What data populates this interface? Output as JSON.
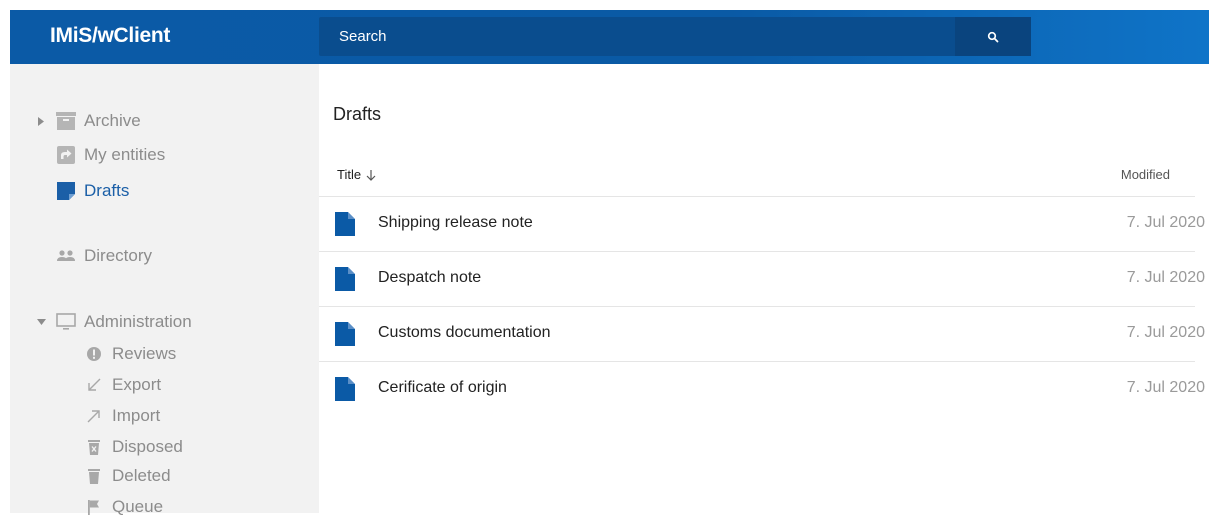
{
  "app": {
    "title": "IMiS/wClient"
  },
  "search": {
    "placeholder": "Search"
  },
  "sidebar": {
    "items": [
      {
        "label": "Archive"
      },
      {
        "label": "My entities"
      },
      {
        "label": "Drafts"
      },
      {
        "label": "Directory"
      },
      {
        "label": "Administration"
      },
      {
        "label": "Reviews"
      },
      {
        "label": "Export"
      },
      {
        "label": "Import"
      },
      {
        "label": "Disposed"
      },
      {
        "label": "Deleted"
      },
      {
        "label": "Queue"
      }
    ],
    "active": "Drafts"
  },
  "main": {
    "title": "Drafts",
    "columns": {
      "title": "Title",
      "modified": "Modified"
    },
    "rows": [
      {
        "title": "Shipping release note",
        "modified": "7. Jul 2020"
      },
      {
        "title": "Despatch note",
        "modified": "7. Jul 2020"
      },
      {
        "title": "Customs documentation",
        "modified": "7. Jul 2020"
      },
      {
        "title": "Cerificate of origin",
        "modified": "7. Jul 2020"
      }
    ]
  },
  "colors": {
    "brand": "#0b5aa6",
    "accent": "#1b5fa7",
    "sidebar_bg": "#f2f2f2",
    "muted": "#8c8c8c"
  },
  "icons": {
    "archive": "archive-box-icon",
    "my_entities": "share-square-icon",
    "drafts": "draft-note-icon",
    "directory": "people-icon",
    "administration": "monitor-icon",
    "reviews": "alert-circle-icon",
    "export": "arrow-down-left-icon",
    "import": "arrow-up-right-icon",
    "disposed": "trash-x-icon",
    "deleted": "trash-icon",
    "queue": "flag-icon",
    "document": "document-icon",
    "search": "search-icon"
  }
}
